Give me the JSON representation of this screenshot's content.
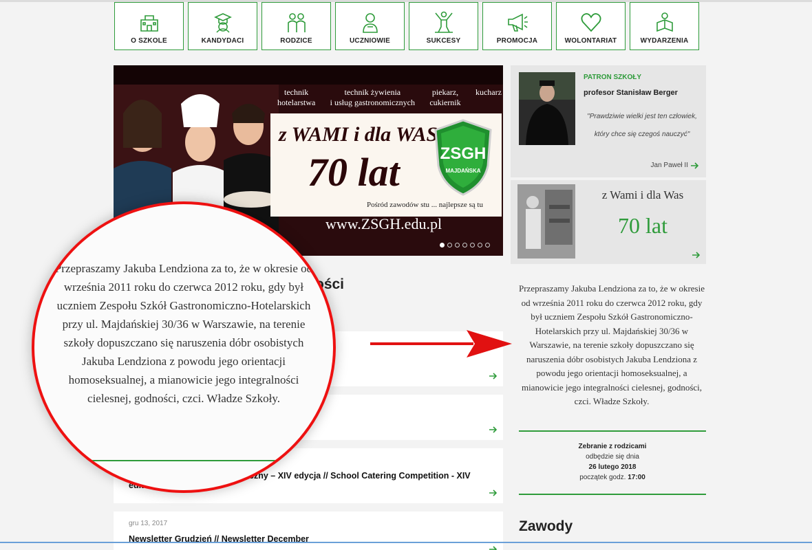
{
  "nav": [
    {
      "label": "O SZKOLE",
      "icon": "school-building-icon"
    },
    {
      "label": "KANDYDACI",
      "icon": "graduate-icon"
    },
    {
      "label": "RODZICE",
      "icon": "parents-icon"
    },
    {
      "label": "UCZNIOWIE",
      "icon": "student-icon"
    },
    {
      "label": "SUKCESY",
      "icon": "winner-icon"
    },
    {
      "label": "PROMOCJA",
      "icon": "megaphone-icon"
    },
    {
      "label": "WOLONTARIAT",
      "icon": "heart-icon"
    },
    {
      "label": "WYDARZENIA",
      "icon": "events-icon"
    }
  ],
  "hero": {
    "careers": [
      {
        "line1": "technik",
        "line2": "hotelarstwa"
      },
      {
        "line1": "technik żywienia",
        "line2": "i usług gastronomicznych"
      },
      {
        "line1": "piekarz,",
        "line2": "cukiernik"
      },
      {
        "line1": "kucharz",
        "line2": ""
      }
    ],
    "slogan": "z WAMI i dla WAS",
    "years": "70 lat",
    "logo_text": "ZSGH",
    "logo_sub": "MAJDAŃSKA",
    "motto": "Pośród zawodów stu ... najlepsze są tu",
    "url": "www.ZSGH.edu.pl",
    "slide_count": 7,
    "active_slide": 1
  },
  "patron": {
    "tag": "PATRON SZKOŁY",
    "name": "profesor Stanisław Berger",
    "quote": "\"Prawdziwie wielki jest ten człowiek, który chce się czegoś nauczyć\"",
    "author": "Jan Paweł II"
  },
  "anniversary": {
    "line1": "z Wami i dla Was",
    "line2": "70 lat"
  },
  "news": {
    "heading_visible": "ości",
    "cards": [
      {
        "date": "",
        "title": ""
      },
      {
        "date": "",
        "title": ""
      },
      {
        "date": "",
        "title": "Szkolny Konkurs Gastronomiczny – XIV edycja // School Catering Competition - XIV edition"
      },
      {
        "date": "gru 13, 2017",
        "title": "Newsletter Grudzień // Newsletter December"
      }
    ]
  },
  "apology": {
    "text": "Przepraszamy Jakuba Lendziona za to, że w okresie od września 2011 roku do czerwca 2012 roku, gdy był uczniem Zespołu Szkół Gastronomiczno-Hotelarskich przy ul. Majdańskiej 30/36 w Warszawie, na terenie szkoły dopuszczano się naruszenia dóbr osobistych Jakuba Lendziona z powodu jego orientacji homoseksualnej, a mianowicie jego integralności cielesnej, godności, czci. Władze Szkoły."
  },
  "meeting": {
    "title": "Zebranie z rodzicami",
    "line2": "odbędzie się dnia",
    "date": "26 lutego 2018",
    "time_label": "początek godz.",
    "time": "17:00"
  },
  "sidebar_heading": "Zawody",
  "colors": {
    "accent": "#2e9b3a",
    "highlight": "#e11111"
  }
}
